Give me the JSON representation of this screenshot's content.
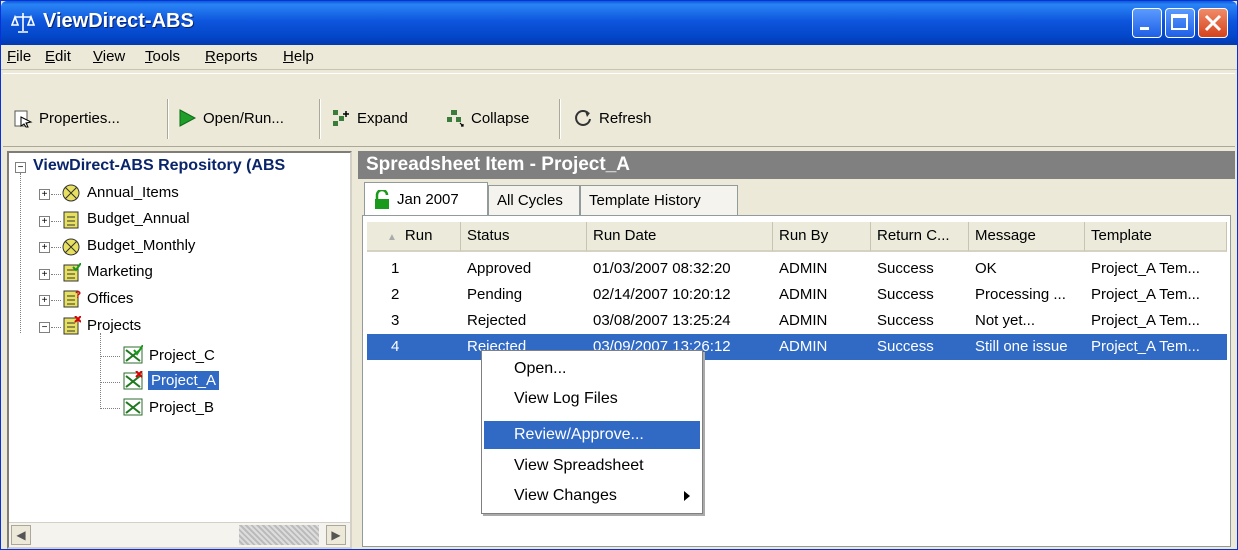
{
  "window": {
    "title": "ViewDirect-ABS"
  },
  "menu": {
    "items": [
      {
        "pre": "",
        "u": "F",
        "post": "ile"
      },
      {
        "pre": "",
        "u": "E",
        "post": "dit"
      },
      {
        "pre": "",
        "u": "V",
        "post": "iew"
      },
      {
        "pre": "",
        "u": "T",
        "post": "ools"
      },
      {
        "pre": "",
        "u": "R",
        "post": "eports"
      },
      {
        "pre": "",
        "u": "H",
        "post": "elp"
      }
    ]
  },
  "toolbar": {
    "properties_label": "Properties...",
    "open_run_label": "Open/Run...",
    "expand_label": "Expand",
    "collapse_label": "Collapse",
    "refresh_label": "Refresh"
  },
  "tree": {
    "root": "ViewDirect-ABS Repository (ABS",
    "items": [
      {
        "label": "Annual_Items"
      },
      {
        "label": "Budget_Annual"
      },
      {
        "label": "Budget_Monthly"
      },
      {
        "label": "Marketing"
      },
      {
        "label": "Offices"
      },
      {
        "label": "Projects"
      }
    ],
    "children": [
      {
        "label": "Project_C"
      },
      {
        "label": "Project_A"
      },
      {
        "label": "Project_B"
      }
    ]
  },
  "panel": {
    "header": "Spreadsheet Item - Project_A",
    "tabs": [
      {
        "label": "Jan 2007"
      },
      {
        "label": "All Cycles"
      },
      {
        "label": "Template History"
      }
    ],
    "columns": [
      "Run",
      "Status",
      "Run Date",
      "Run By",
      "Return C...",
      "Message",
      "Template"
    ],
    "rows": [
      {
        "run": "1",
        "status": "Approved",
        "date": "01/03/2007 08:32:20",
        "by": "ADMIN",
        "ret": "Success",
        "msg": "OK",
        "tmpl": "Project_A Tem..."
      },
      {
        "run": "2",
        "status": "Pending",
        "date": "02/14/2007 10:20:12",
        "by": "ADMIN",
        "ret": "Success",
        "msg": "Processing ...",
        "tmpl": "Project_A Tem..."
      },
      {
        "run": "3",
        "status": "Rejected",
        "date": "03/08/2007 13:25:24",
        "by": "ADMIN",
        "ret": "Success",
        "msg": "Not yet...",
        "tmpl": "Project_A Tem..."
      },
      {
        "run": "4",
        "status": "Rejected",
        "date": "03/09/2007 13:26:12",
        "by": "ADMIN",
        "ret": "Success",
        "msg": "Still one issue",
        "tmpl": "Project_A Tem..."
      }
    ]
  },
  "context_menu": {
    "items": [
      {
        "label": "Open..."
      },
      {
        "label": "View Log Files"
      },
      {
        "label": "Review/Approve..."
      },
      {
        "label": "View Spreadsheet"
      },
      {
        "label": "View Changes"
      }
    ]
  },
  "colors": {
    "title_blue": "#0347c9",
    "selection": "#316ac5",
    "header_gray": "#808080"
  },
  "icons": [
    "app-icon",
    "properties-icon",
    "play-icon",
    "expand-icon",
    "collapse-icon",
    "refresh-icon",
    "lock-icon",
    "spreadsheet-icon",
    "folder-icon"
  ]
}
